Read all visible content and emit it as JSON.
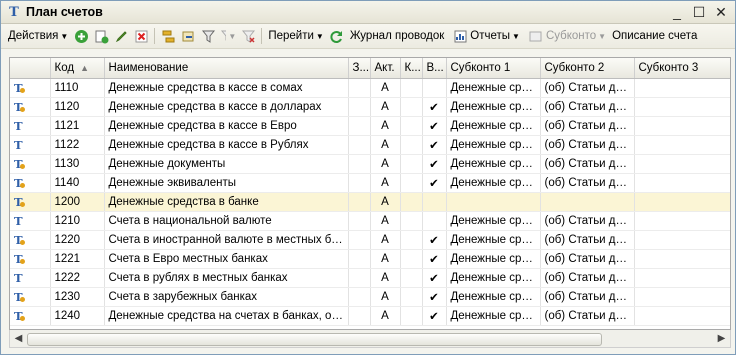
{
  "window": {
    "title": "План счетов",
    "controls": {
      "minimize": "_",
      "maximize": "☐",
      "close": "✕"
    }
  },
  "toolbar": {
    "actions_label": "Действия",
    "goto_label": "Перейти",
    "journal_label": "Журнал проводок",
    "reports_label": "Отчеты",
    "subkonto_label": "Субконто",
    "description_label": "Описание счета"
  },
  "grid": {
    "columns": [
      "",
      "Код",
      "Наименование",
      "З...",
      "Акт.",
      "К...",
      "В...",
      "Субконто 1",
      "Субконто 2",
      "Субконто 3"
    ],
    "rows": [
      {
        "icon": "account-folder-icon",
        "code": "1110",
        "name": "Денежные средства в кассе в сомах",
        "z": "",
        "act": "А",
        "k": "",
        "v": "",
        "s1": "Денежные сре...",
        "s2": "(об) Статьи дви...",
        "s3": ""
      },
      {
        "icon": "account-folder-icon",
        "code": "1120",
        "name": "Денежные средства в кассе в долларах",
        "z": "",
        "act": "А",
        "k": "",
        "v": "✔",
        "s1": "Денежные сре...",
        "s2": "(об) Статьи дви...",
        "s3": ""
      },
      {
        "icon": "account-icon",
        "code": "1121",
        "name": "Денежные средства в кассе в Евро",
        "z": "",
        "act": "А",
        "k": "",
        "v": "✔",
        "s1": "Денежные сре...",
        "s2": "(об) Статьи дви...",
        "s3": ""
      },
      {
        "icon": "account-icon",
        "code": "1122",
        "name": "Денежные средства в кассе в Рублях",
        "z": "",
        "act": "А",
        "k": "",
        "v": "✔",
        "s1": "Денежные сре...",
        "s2": "(об) Статьи дви...",
        "s3": ""
      },
      {
        "icon": "account-folder-icon",
        "code": "1130",
        "name": "Денежные документы",
        "z": "",
        "act": "А",
        "k": "",
        "v": "✔",
        "s1": "Денежные сре...",
        "s2": "(об) Статьи дви...",
        "s3": ""
      },
      {
        "icon": "account-folder-icon",
        "code": "1140",
        "name": "Денежные эквиваленты",
        "z": "",
        "act": "А",
        "k": "",
        "v": "✔",
        "s1": "Денежные сре...",
        "s2": "(об) Статьи дви...",
        "s3": ""
      },
      {
        "icon": "account-folder-icon",
        "code": "1200",
        "name": "Денежные средства в банке",
        "z": "",
        "act": "А",
        "k": "",
        "v": "",
        "s1": "",
        "s2": "",
        "s3": "",
        "selected": true
      },
      {
        "icon": "account-icon",
        "code": "1210",
        "name": "Счета в национальной валюте",
        "z": "",
        "act": "А",
        "k": "",
        "v": "",
        "s1": "Денежные сре...",
        "s2": "(об) Статьи дви...",
        "s3": ""
      },
      {
        "icon": "account-folder-icon",
        "code": "1220",
        "name": "Счета в иностранной валюте в местных бан...",
        "z": "",
        "act": "А",
        "k": "",
        "v": "✔",
        "s1": "Денежные сре...",
        "s2": "(об) Статьи дви...",
        "s3": ""
      },
      {
        "icon": "account-folder-icon",
        "code": "1221",
        "name": "Счета в Евро местных банках",
        "z": "",
        "act": "А",
        "k": "",
        "v": "✔",
        "s1": "Денежные сре...",
        "s2": "(об) Статьи дви...",
        "s3": ""
      },
      {
        "icon": "account-icon",
        "code": "1222",
        "name": "Счета в рублях в местных банках",
        "z": "",
        "act": "А",
        "k": "",
        "v": "✔",
        "s1": "Денежные сре...",
        "s2": "(об) Статьи дви...",
        "s3": ""
      },
      {
        "icon": "account-folder-icon",
        "code": "1230",
        "name": "Счета в зарубежных банках",
        "z": "",
        "act": "А",
        "k": "",
        "v": "✔",
        "s1": "Денежные сре...",
        "s2": "(об) Статьи дви...",
        "s3": ""
      },
      {
        "icon": "account-folder-icon",
        "code": "1240",
        "name": "Денежные средства на счетах в банках, ог...",
        "z": "",
        "act": "А",
        "k": "",
        "v": "✔",
        "s1": "Денежные сре...",
        "s2": "(об) Статьи дви...",
        "s3": ""
      }
    ]
  },
  "colors": {
    "accent": "#2f5fa8",
    "selected_row": "#fbf5d5"
  }
}
